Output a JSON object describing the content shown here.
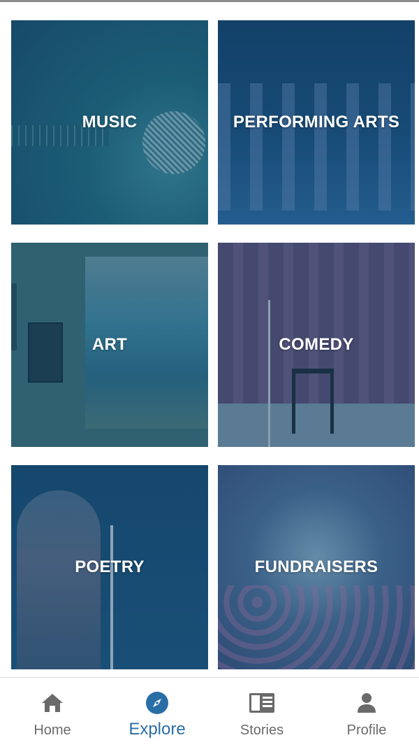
{
  "categories": [
    {
      "label": "MUSIC"
    },
    {
      "label": "PERFORMING ARTS"
    },
    {
      "label": "ART"
    },
    {
      "label": "COMEDY"
    },
    {
      "label": "POETRY"
    },
    {
      "label": "FUNDRAISERS"
    }
  ],
  "bottom_nav": {
    "items": [
      {
        "label": "Home",
        "icon": "home-icon"
      },
      {
        "label": "Explore",
        "icon": "compass-icon",
        "active": true
      },
      {
        "label": "Stories",
        "icon": "stories-icon"
      },
      {
        "label": "Profile",
        "icon": "profile-icon"
      }
    ],
    "active_color": "#2a6ea7",
    "inactive_color": "#6a6a6a"
  }
}
